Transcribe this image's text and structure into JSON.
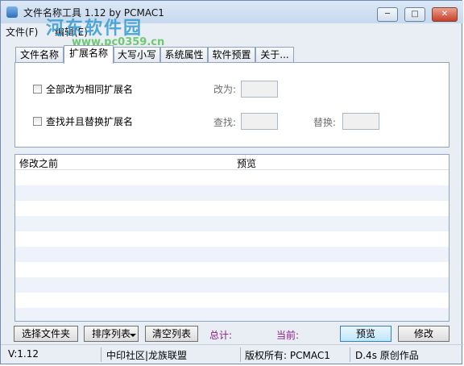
{
  "window": {
    "title": "文件名称工具 1.12  by PCMAC1",
    "min_label": "─",
    "max_label": "□",
    "close_label": "✕"
  },
  "watermark": {
    "site_name": "河东软件园",
    "url": "www.pc0359.cn"
  },
  "menu": [
    "文件(F)",
    "编辑(E)"
  ],
  "tabs": [
    "文件名称",
    "扩展名称",
    "大写小写",
    "系统属性",
    "软件预置",
    "关于..."
  ],
  "active_tab_index": 1,
  "extension_panel": {
    "option1_label": "全部改为相同扩展名",
    "option1_checked": false,
    "change_to_label": "改为:",
    "change_to_value": "",
    "option2_label": "查找并且替换扩展名",
    "option2_checked": false,
    "find_label": "查找:",
    "find_value": "",
    "replace_label": "替换:",
    "replace_value": ""
  },
  "list": {
    "columns": [
      "修改之前",
      "预览"
    ],
    "rows": []
  },
  "buttons": {
    "select_files": "选择文件夹",
    "sort_list": "排序列表",
    "clear_list": "清空列表",
    "preview": "预览",
    "modify": "修改"
  },
  "stats": {
    "total_label": "总计:",
    "current_label": "当前:"
  },
  "statusbar": {
    "version": "V:1.12",
    "community": "中印社区|龙族联盟",
    "copyright": "版权所有: PCMAC1",
    "credit": "D.4s 原创作品"
  },
  "colors": {
    "stat_label": "#8b1a8b",
    "list_stripe": "#eef3fb",
    "watermark": "#349ad2"
  }
}
